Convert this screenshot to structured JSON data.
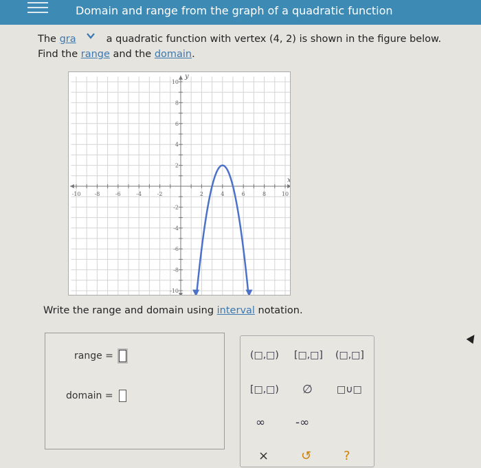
{
  "header": {
    "title": "Domain and range from the graph of a quadratic function"
  },
  "prompt": {
    "pre": "The ",
    "gra": "gra",
    "mid": "a quadratic function with vertex (4, 2) is shown in the figure below.",
    "line2_pre": "Find the ",
    "range_link": "range",
    "and": " and the ",
    "domain_link": "domain",
    "period": "."
  },
  "graph": {
    "x_axis_label": "x",
    "y_axis_label": "y",
    "x_ticks": [
      "-10",
      "-8",
      "-6",
      "-4",
      "-2",
      "2",
      "4",
      "6",
      "8",
      "10"
    ],
    "y_ticks": [
      "10",
      "8",
      "6",
      "4",
      "2",
      "-2",
      "-4",
      "-6",
      "-8",
      "-10"
    ],
    "curve_color": "#4b72c8",
    "vertex": [
      4,
      2
    ]
  },
  "instruction": {
    "pre": "Write the range and domain using ",
    "link": "interval",
    "post": " notation."
  },
  "answer": {
    "range_label": "range =",
    "domain_label": "domain ="
  },
  "keypad": {
    "open_open": "(□,□)",
    "closed_closed": "[□,□]",
    "open_closed": "(□,□]",
    "closed_open": "[□,□)",
    "empty_set": "∅",
    "union": "□∪□",
    "infinity": "∞",
    "neg_infinity": "-∞",
    "clear": "×",
    "undo": "↺",
    "help": "?"
  }
}
